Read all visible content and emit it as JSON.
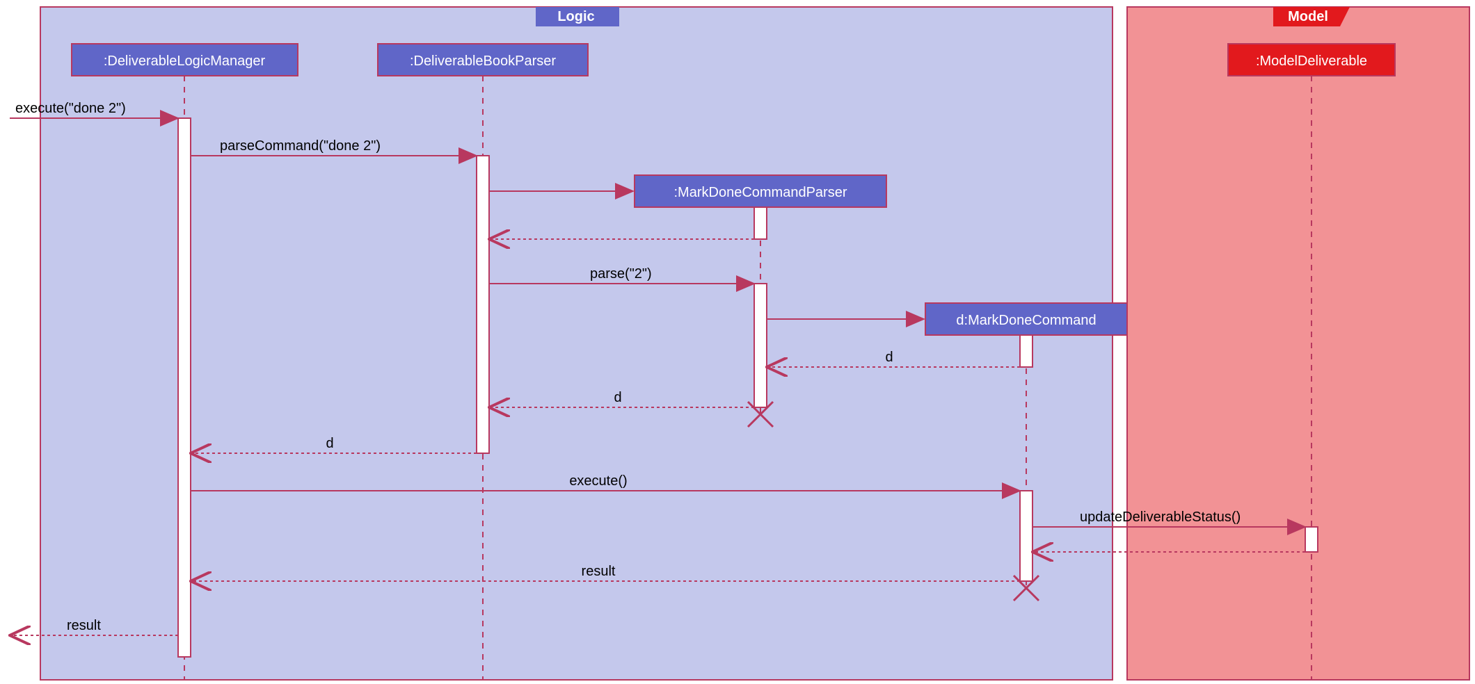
{
  "frames": {
    "logic": {
      "title": "Logic"
    },
    "model": {
      "title": "Model"
    }
  },
  "participants": {
    "dlm": {
      "label": ":DeliverableLogicManager"
    },
    "dbp": {
      "label": ":DeliverableBookParser"
    },
    "mdcp": {
      "label": ":MarkDoneCommandParser"
    },
    "mdc": {
      "label": "d:MarkDoneCommand"
    },
    "md": {
      "label": ":ModelDeliverable"
    }
  },
  "messages": {
    "m1": "execute(\"done 2\")",
    "m2": "parseCommand(\"done 2\")",
    "m3": "parse(\"2\")",
    "m4": "d",
    "m5": "d",
    "m6": "d",
    "m7": "execute()",
    "m8": "updateDeliverableStatus()",
    "m9": "result",
    "m10": "result"
  },
  "chart_data": {
    "type": "sequence-diagram",
    "frames": [
      {
        "name": "Logic",
        "contains": [
          "DeliverableLogicManager",
          "DeliverableBookParser",
          "MarkDoneCommandParser",
          "MarkDoneCommand"
        ]
      },
      {
        "name": "Model",
        "contains": [
          "ModelDeliverable"
        ]
      }
    ],
    "participants": [
      {
        "id": "dlm",
        "name": ":DeliverableLogicManager",
        "created_during": false,
        "destroyed_during": false
      },
      {
        "id": "dbp",
        "name": ":DeliverableBookParser",
        "created_during": false,
        "destroyed_during": false
      },
      {
        "id": "mdcp",
        "name": ":MarkDoneCommandParser",
        "created_during": true,
        "destroyed_during": true
      },
      {
        "id": "mdc",
        "name": "d:MarkDoneCommand",
        "created_during": true,
        "destroyed_during": true
      },
      {
        "id": "md",
        "name": ":ModelDeliverable",
        "created_during": false,
        "destroyed_during": false
      }
    ],
    "interactions": [
      {
        "from": "external",
        "to": "dlm",
        "label": "execute(\"done 2\")",
        "type": "call"
      },
      {
        "from": "dlm",
        "to": "dbp",
        "label": "parseCommand(\"done 2\")",
        "type": "call"
      },
      {
        "from": "dbp",
        "to": "mdcp",
        "label": "",
        "type": "create"
      },
      {
        "from": "mdcp",
        "to": "dbp",
        "label": "",
        "type": "return"
      },
      {
        "from": "dbp",
        "to": "mdcp",
        "label": "parse(\"2\")",
        "type": "call"
      },
      {
        "from": "mdcp",
        "to": "mdc",
        "label": "",
        "type": "create"
      },
      {
        "from": "mdc",
        "to": "mdcp",
        "label": "d",
        "type": "return"
      },
      {
        "from": "mdcp",
        "to": "dbp",
        "label": "d",
        "type": "return"
      },
      {
        "from": "mdcp",
        "to": null,
        "label": "",
        "type": "destroy"
      },
      {
        "from": "dbp",
        "to": "dlm",
        "label": "d",
        "type": "return"
      },
      {
        "from": "dlm",
        "to": "mdc",
        "label": "execute()",
        "type": "call"
      },
      {
        "from": "mdc",
        "to": "md",
        "label": "updateDeliverableStatus()",
        "type": "call"
      },
      {
        "from": "md",
        "to": "mdc",
        "label": "",
        "type": "return"
      },
      {
        "from": "mdc",
        "to": "dlm",
        "label": "result",
        "type": "return"
      },
      {
        "from": "mdc",
        "to": null,
        "label": "",
        "type": "destroy"
      },
      {
        "from": "dlm",
        "to": "external",
        "label": "result",
        "type": "return"
      }
    ]
  }
}
